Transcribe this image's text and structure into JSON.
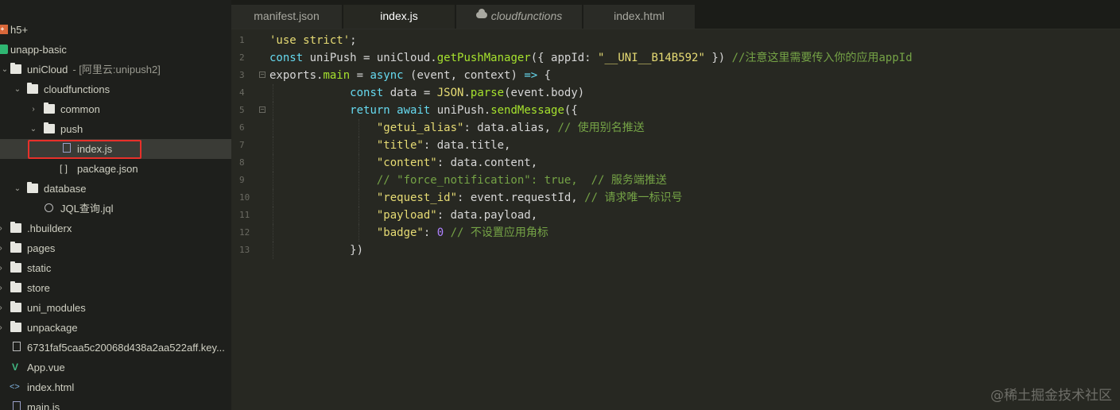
{
  "sidebar": {
    "items": [
      {
        "label": "h5+",
        "icon": "h5-plus-icon",
        "suffix": ""
      },
      {
        "label": "unapp-basic",
        "icon": "uni-project-icon",
        "suffix": ""
      },
      {
        "label": "uniCloud",
        "icon": "folder-open-icon",
        "suffix": "- [阿里云:unipush2]"
      },
      {
        "label": "cloudfunctions",
        "icon": "folder-open-icon",
        "suffix": ""
      },
      {
        "label": "common",
        "icon": "folder-icon",
        "suffix": ""
      },
      {
        "label": "push",
        "icon": "folder-open-icon",
        "suffix": ""
      },
      {
        "label": "index.js",
        "icon": "js-file-icon",
        "suffix": ""
      },
      {
        "label": "package.json",
        "icon": "json-file-icon",
        "suffix": ""
      },
      {
        "label": "database",
        "icon": "folder-open-icon",
        "suffix": ""
      },
      {
        "label": "JQL查询.jql",
        "icon": "jql-file-icon",
        "suffix": ""
      },
      {
        "label": ".hbuilderx",
        "icon": "folder-icon",
        "suffix": ""
      },
      {
        "label": "pages",
        "icon": "folder-icon",
        "suffix": ""
      },
      {
        "label": "static",
        "icon": "folder-icon",
        "suffix": ""
      },
      {
        "label": "store",
        "icon": "folder-icon",
        "suffix": ""
      },
      {
        "label": "uni_modules",
        "icon": "folder-icon",
        "suffix": ""
      },
      {
        "label": "unpackage",
        "icon": "folder-icon",
        "suffix": ""
      },
      {
        "label": "6731faf5caa5c20068d438a2aa522aff.key...",
        "icon": "key-file-icon",
        "suffix": ""
      },
      {
        "label": "App.vue",
        "icon": "vue-file-icon",
        "suffix": ""
      },
      {
        "label": "index.html",
        "icon": "html-file-icon",
        "suffix": ""
      },
      {
        "label": "main.js",
        "icon": "js-file-icon",
        "suffix": ""
      }
    ]
  },
  "tabs": [
    {
      "label": "manifest.json"
    },
    {
      "label": "index.js"
    },
    {
      "label": "cloudfunctions"
    },
    {
      "label": "index.html"
    }
  ],
  "editor": {
    "lines": [
      {
        "n": "1",
        "tokens": [
          [
            "str",
            "'use strict'"
          ],
          [
            "pl",
            ";"
          ]
        ]
      },
      {
        "n": "2",
        "tokens": [
          [
            "kw",
            "const"
          ],
          [
            "pl",
            " uniPush = uniCloud."
          ],
          [
            "fn",
            "getPushManager"
          ],
          [
            "pl",
            "({ appId: "
          ],
          [
            "str",
            "\"__UNI__B14B592\""
          ],
          [
            "pl",
            " }) "
          ],
          [
            "cm",
            "//注意这里需要传入你的应用appId"
          ]
        ]
      },
      {
        "n": "3",
        "tokens": [
          [
            "pl",
            "exports."
          ],
          [
            "fn",
            "main"
          ],
          [
            "pl",
            " = "
          ],
          [
            "kw",
            "async"
          ],
          [
            "pl",
            " (event, context) "
          ],
          [
            "kw",
            "=>"
          ],
          [
            "pl",
            " {"
          ]
        ]
      },
      {
        "n": "4",
        "tokens": [
          [
            "pl",
            "            "
          ],
          [
            "kw",
            "const"
          ],
          [
            "pl",
            " data = "
          ],
          [
            "cls",
            "JSON"
          ],
          [
            "pl",
            "."
          ],
          [
            "fn",
            "parse"
          ],
          [
            "pl",
            "(event.body)"
          ]
        ]
      },
      {
        "n": "5",
        "tokens": [
          [
            "pl",
            "            "
          ],
          [
            "kw",
            "return"
          ],
          [
            "pl",
            " "
          ],
          [
            "kw",
            "await"
          ],
          [
            "pl",
            " uniPush."
          ],
          [
            "fn",
            "sendMessage"
          ],
          [
            "pl",
            "({"
          ]
        ]
      },
      {
        "n": "6",
        "tokens": [
          [
            "pl",
            "                "
          ],
          [
            "str",
            "\"getui_alias\""
          ],
          [
            "pl",
            ": data.alias, "
          ],
          [
            "cm",
            "// 使用别名推送"
          ]
        ]
      },
      {
        "n": "7",
        "tokens": [
          [
            "pl",
            "                "
          ],
          [
            "str",
            "\"title\""
          ],
          [
            "pl",
            ": data.title,"
          ]
        ]
      },
      {
        "n": "8",
        "tokens": [
          [
            "pl",
            "                "
          ],
          [
            "str",
            "\"content\""
          ],
          [
            "pl",
            ": data.content,"
          ]
        ]
      },
      {
        "n": "9",
        "tokens": [
          [
            "pl",
            "                "
          ],
          [
            "cm",
            "// \"force_notification\": true,  // 服务端推送"
          ]
        ]
      },
      {
        "n": "10",
        "tokens": [
          [
            "pl",
            "                "
          ],
          [
            "str",
            "\"request_id\""
          ],
          [
            "pl",
            ": event.requestId, "
          ],
          [
            "cm",
            "// 请求唯一标识号"
          ]
        ]
      },
      {
        "n": "11",
        "tokens": [
          [
            "pl",
            "                "
          ],
          [
            "str",
            "\"payload\""
          ],
          [
            "pl",
            ": data.payload,"
          ]
        ]
      },
      {
        "n": "12",
        "tokens": [
          [
            "pl",
            "                "
          ],
          [
            "str",
            "\"badge\""
          ],
          [
            "pl",
            ": "
          ],
          [
            "num",
            "0"
          ],
          [
            "pl",
            " "
          ],
          [
            "cm",
            "// 不设置应用角标"
          ]
        ]
      },
      {
        "n": "13",
        "tokens": [
          [
            "pl",
            "            })"
          ]
        ]
      }
    ]
  },
  "watermark": "@稀土掘金技术社区"
}
